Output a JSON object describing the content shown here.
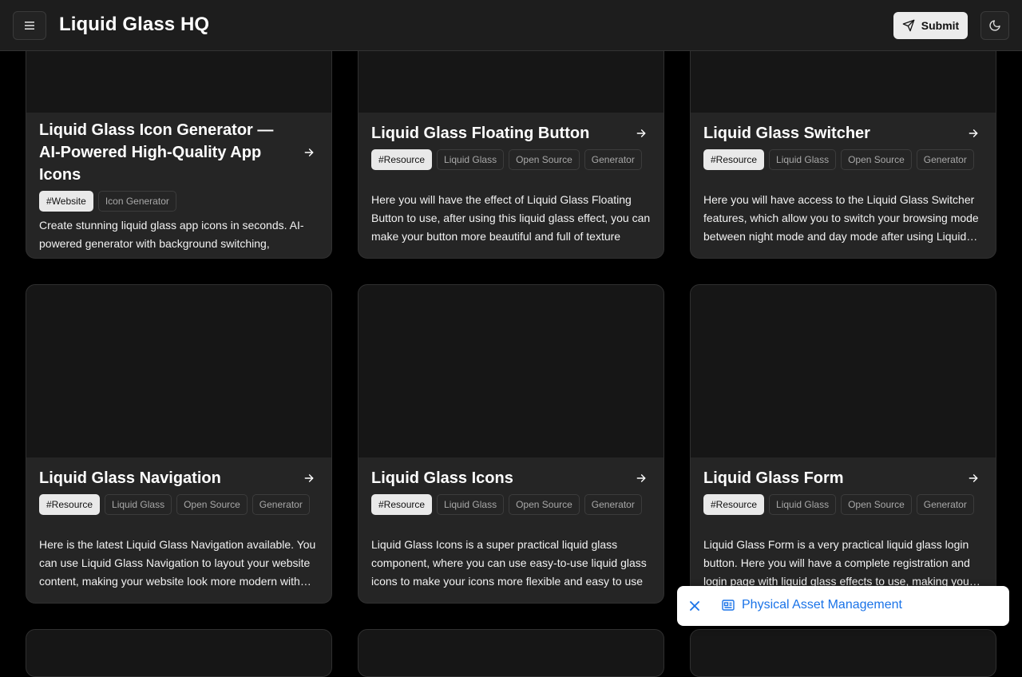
{
  "header": {
    "title": "Liquid Glass HQ",
    "submit_label": "Submit",
    "menu_icon": "hamburger-menu-icon",
    "theme_icon": "moon-icon"
  },
  "cards": [
    {
      "title": "Liquid Glass Icon Generator — AI-Powered High-Quality App Icons",
      "tags": [
        "#Website",
        "Icon Generator"
      ],
      "description": "Create stunning liquid glass app icons in seconds. AI-powered generator with background switching,"
    },
    {
      "title": "Liquid Glass Floating Button",
      "tags": [
        "#Resource",
        "Liquid Glass",
        "Open Source",
        "Generator"
      ],
      "description": "Here you will have the effect of Liquid Glass Floating Button to use, after using this liquid glass effect, you can make your button more beautiful and full of texture"
    },
    {
      "title": "Liquid Glass Switcher",
      "tags": [
        "#Resource",
        "Liquid Glass",
        "Open Source",
        "Generator"
      ],
      "description": "Here you will have access to the Liquid Glass Switcher features, which allow you to switch your browsing mode between night mode and day mode after using Liquid Glass effects."
    },
    {
      "title": "Liquid Glass Navigation",
      "tags": [
        "#Resource",
        "Liquid Glass",
        "Open Source",
        "Generator"
      ],
      "description": "Here is the latest Liquid Glass Navigation available. You can use Liquid Glass Navigation to layout your website content, making your website look more modern with liquid glass effects."
    },
    {
      "title": "Liquid Glass Icons",
      "tags": [
        "#Resource",
        "Liquid Glass",
        "Open Source",
        "Generator"
      ],
      "description": "Liquid Glass Icons is a super practical liquid glass component, where you can use easy-to-use liquid glass icons to make your icons more flexible and easy to use"
    },
    {
      "title": "Liquid Glass Form",
      "tags": [
        "#Resource",
        "Liquid Glass",
        "Open Source",
        "Generator"
      ],
      "description": "Liquid Glass Form is a very practical liquid glass login button. Here you will have a complete registration and login page with liquid glass effects to use, making your website more beautiful."
    }
  ],
  "toast": {
    "label": "Physical Asset Management",
    "icon": "news-icon",
    "close_icon": "close-icon"
  },
  "colors": {
    "background": "#000000",
    "card": "#252525",
    "link": "#1a73e8"
  }
}
